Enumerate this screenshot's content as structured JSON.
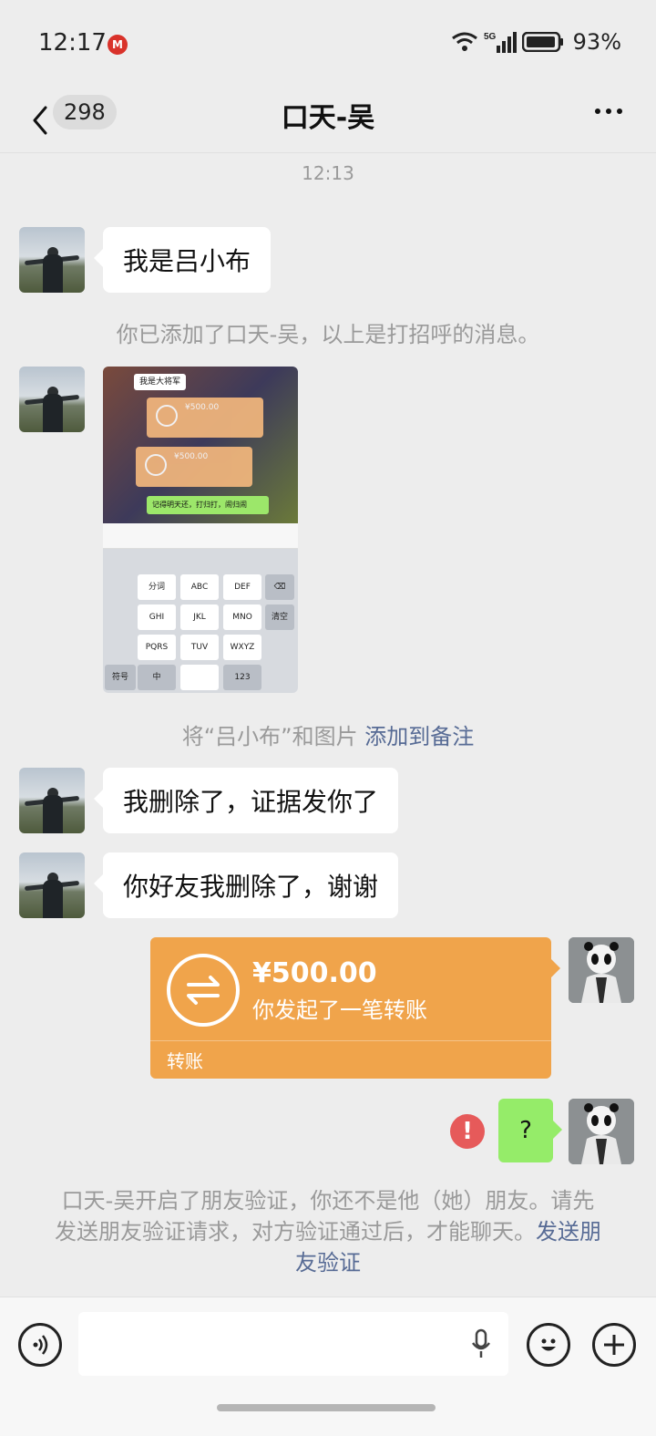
{
  "status_bar": {
    "time": "12:17",
    "carrier_icon": "china-mobile-icon",
    "battery_percent": "93%",
    "network": "5G"
  },
  "nav": {
    "unread_count": "298",
    "title": "口天-吴"
  },
  "chat": {
    "timestamp": "12:13",
    "messages": [
      {
        "text": "我是吕小布"
      },
      {
        "text": "我删除了，证据发你了"
      },
      {
        "text": "你好友我删除了，谢谢"
      }
    ],
    "system_added": "你已添加了口天-吴，以上是打招呼的消息。",
    "remark_prefix": "将“吕小布”和图片",
    "remark_link": "添加到备注",
    "screenshot": {
      "chip": "我是大将军",
      "card1_amount": "¥500.00",
      "card2_amount": "¥500.00",
      "green_msg": "记得明天还，打归打，闹归闹",
      "keys": [
        "分词",
        "ABC",
        "DEF",
        "GHI",
        "JKL",
        "MNO",
        "PQRS",
        "TUV",
        "WXYZ",
        "符号",
        "中",
        "123",
        "清空"
      ]
    },
    "transfer": {
      "amount": "¥500.00",
      "description": "你发起了一笔转账",
      "label": "转账"
    },
    "question_text": "?",
    "verify_text": "口天-吴开启了朋友验证，你还不是他（她）朋友。请先发送朋友验证请求，对方验证通过后，才能聊天。",
    "verify_link": "发送朋友验证"
  },
  "colors": {
    "background": "#ededed",
    "transfer": "#f0a44b",
    "self_bubble": "#95ec69",
    "link": "#576b95",
    "error": "#e65a5a"
  }
}
